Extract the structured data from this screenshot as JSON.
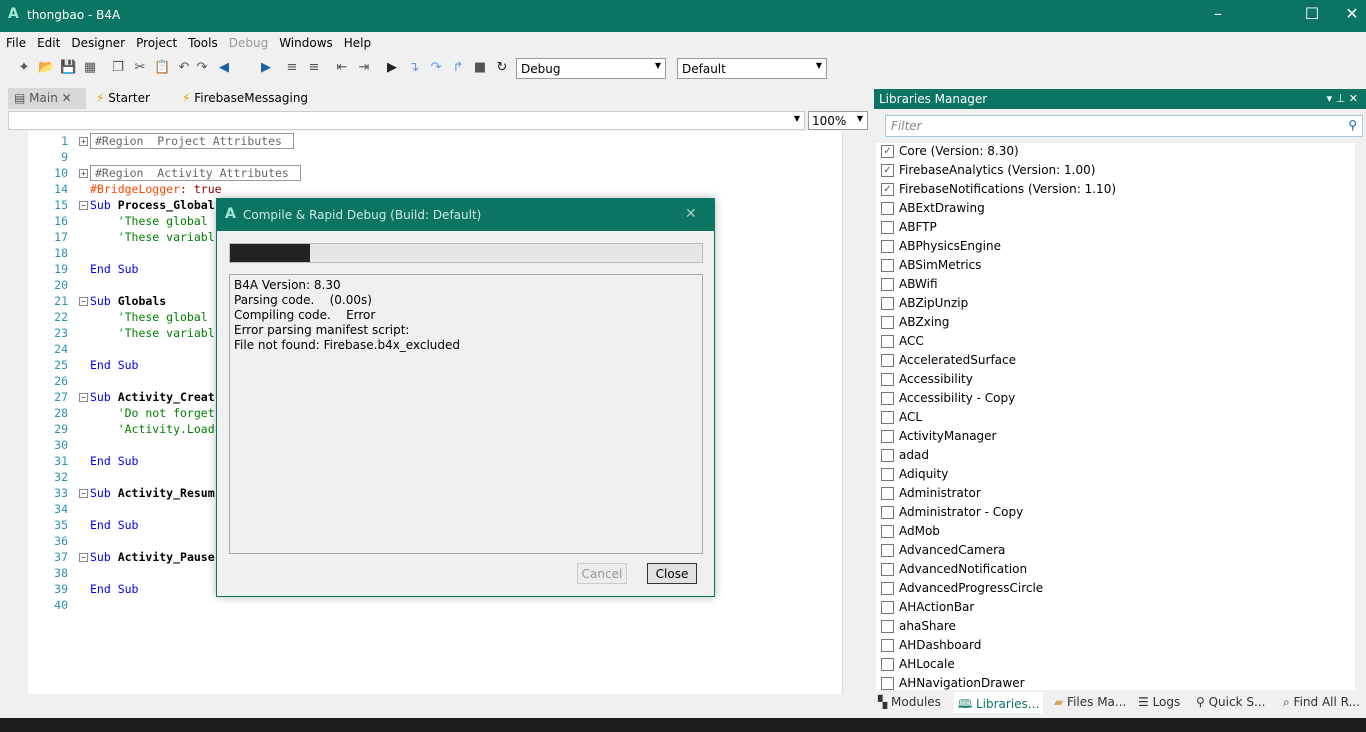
{
  "window": {
    "title": "thongbao - B4A",
    "logo": "A",
    "minimize": "–",
    "maximize": "☐",
    "close": "✕",
    "accent": "#0b7463"
  },
  "menu": [
    "File",
    "Edit",
    "Designer",
    "Project",
    "Tools",
    "Debug",
    "Windows",
    "Help"
  ],
  "toolbar": {
    "icons": [
      "new-file-icon",
      "open-icon",
      "save-icon",
      "save-all-icon",
      "copy-icon",
      "cut-icon",
      "paste-icon",
      "undo-icon",
      "redo-icon",
      "back-icon",
      "forward-icon",
      "comment-icon",
      "uncomment-icon",
      "outdent-icon",
      "indent-icon",
      "run-icon",
      "step-into-icon",
      "step-over-icon",
      "step-out-icon",
      "stop-icon",
      "restart-icon"
    ],
    "build_mode": "Debug",
    "build_config": "Default"
  },
  "tabs": [
    {
      "label": "Main",
      "icon": "designer-icon"
    },
    {
      "label": "Starter",
      "icon": "lightning-icon"
    },
    {
      "label": "FirebaseMessaging",
      "icon": "lightning-icon"
    }
  ],
  "editor": {
    "zoom": "100%",
    "lines": [
      {
        "n": "1",
        "fold": "+",
        "seg": [
          {
            "t": "#Region  Project Attributes ",
            "c": "rg"
          }
        ]
      },
      {
        "n": "9",
        "seg": []
      },
      {
        "n": "10",
        "fold": "+",
        "seg": [
          {
            "t": "#Region  Activity Attributes ",
            "c": "rg"
          }
        ]
      },
      {
        "n": "14",
        "seg": [
          {
            "t": "#BridgeLogger",
            "c": "dir"
          },
          {
            "t": ": true",
            "c": "val"
          }
        ]
      },
      {
        "n": "15",
        "fold": "-",
        "seg": [
          {
            "t": "Sub ",
            "c": "kw"
          },
          {
            "t": "Process_Global",
            "c": "id"
          }
        ]
      },
      {
        "n": "16",
        "seg": [
          {
            "t": "    'These global",
            "c": "cm"
          }
        ]
      },
      {
        "n": "17",
        "seg": [
          {
            "t": "    'These variabl",
            "c": "cm"
          }
        ]
      },
      {
        "n": "18",
        "seg": []
      },
      {
        "n": "19",
        "seg": [
          {
            "t": "End Sub",
            "c": "kw"
          }
        ]
      },
      {
        "n": "20",
        "seg": []
      },
      {
        "n": "21",
        "fold": "-",
        "seg": [
          {
            "t": "Sub ",
            "c": "kw"
          },
          {
            "t": "Globals",
            "c": "id"
          }
        ]
      },
      {
        "n": "22",
        "seg": [
          {
            "t": "    'These global",
            "c": "cm"
          }
        ]
      },
      {
        "n": "23",
        "seg": [
          {
            "t": "    'These variabl",
            "c": "cm"
          }
        ]
      },
      {
        "n": "24",
        "seg": []
      },
      {
        "n": "25",
        "seg": [
          {
            "t": "End Sub",
            "c": "kw"
          }
        ]
      },
      {
        "n": "26",
        "seg": []
      },
      {
        "n": "27",
        "fold": "-",
        "seg": [
          {
            "t": "Sub ",
            "c": "kw"
          },
          {
            "t": "Activity_Creat",
            "c": "id"
          }
        ]
      },
      {
        "n": "28",
        "seg": [
          {
            "t": "    'Do not forget",
            "c": "cm"
          }
        ]
      },
      {
        "n": "29",
        "seg": [
          {
            "t": "    'Activity.Load",
            "c": "cm"
          }
        ]
      },
      {
        "n": "30",
        "seg": []
      },
      {
        "n": "31",
        "seg": [
          {
            "t": "End Sub",
            "c": "kw"
          }
        ]
      },
      {
        "n": "32",
        "seg": []
      },
      {
        "n": "33",
        "fold": "-",
        "seg": [
          {
            "t": "Sub ",
            "c": "kw"
          },
          {
            "t": "Activity_Resum",
            "c": "id"
          }
        ]
      },
      {
        "n": "34",
        "seg": []
      },
      {
        "n": "35",
        "seg": [
          {
            "t": "End Sub",
            "c": "kw"
          }
        ]
      },
      {
        "n": "36",
        "seg": []
      },
      {
        "n": "37",
        "fold": "-",
        "seg": [
          {
            "t": "Sub ",
            "c": "kw"
          },
          {
            "t": "Activity_Pause",
            "c": "id"
          }
        ]
      },
      {
        "n": "38",
        "seg": []
      },
      {
        "n": "39",
        "seg": [
          {
            "t": "End Sub",
            "c": "kw"
          }
        ]
      },
      {
        "n": "40",
        "seg": []
      }
    ]
  },
  "libraries": {
    "title": "Libraries Manager",
    "filter_placeholder": "Filter",
    "items": [
      {
        "label": "Core (Version: 8.30)",
        "checked": true
      },
      {
        "label": "FirebaseAnalytics (Version: 1.00)",
        "checked": true
      },
      {
        "label": "FirebaseNotifications (Version: 1.10)",
        "checked": true
      },
      {
        "label": "ABExtDrawing",
        "checked": false
      },
      {
        "label": "ABFTP",
        "checked": false
      },
      {
        "label": "ABPhysicsEngine",
        "checked": false
      },
      {
        "label": "ABSimMetrics",
        "checked": false
      },
      {
        "label": "ABWifi",
        "checked": false
      },
      {
        "label": "ABZipUnzip",
        "checked": false
      },
      {
        "label": "ABZxing",
        "checked": false
      },
      {
        "label": "ACC",
        "checked": false
      },
      {
        "label": "AcceleratedSurface",
        "checked": false
      },
      {
        "label": "Accessibility",
        "checked": false
      },
      {
        "label": "Accessibility - Copy",
        "checked": false
      },
      {
        "label": "ACL",
        "checked": false
      },
      {
        "label": "ActivityManager",
        "checked": false
      },
      {
        "label": "adad",
        "checked": false
      },
      {
        "label": "Adiquity",
        "checked": false
      },
      {
        "label": "Administrator",
        "checked": false
      },
      {
        "label": "Administrator - Copy",
        "checked": false
      },
      {
        "label": "AdMob",
        "checked": false
      },
      {
        "label": "AdvancedCamera",
        "checked": false
      },
      {
        "label": "AdvancedNotification",
        "checked": false
      },
      {
        "label": "AdvancedProgressCircle",
        "checked": false
      },
      {
        "label": "AHActionBar",
        "checked": false
      },
      {
        "label": "ahaShare",
        "checked": false
      },
      {
        "label": "AHDashboard",
        "checked": false
      },
      {
        "label": "AHLocale",
        "checked": false
      },
      {
        "label": "AHNavigationDrawer",
        "checked": false
      }
    ]
  },
  "bottom_tabs": [
    {
      "label": "Modules",
      "icon": "modules-icon"
    },
    {
      "label": "Libraries...",
      "icon": "book-icon",
      "active": true
    },
    {
      "label": "Files Ma...",
      "icon": "folder-icon"
    },
    {
      "label": "Logs",
      "icon": "logs-icon"
    },
    {
      "label": "Quick S...",
      "icon": "search-icon"
    },
    {
      "label": "Find All R...",
      "icon": "find-references-icon"
    }
  ],
  "dialog": {
    "title": "Compile & Rapid Debug (Build: Default)",
    "progress_percent": 17,
    "log": [
      "B4A Version: 8.30",
      "Parsing code.    (0.00s)",
      "Compiling code.    Error",
      "Error parsing manifest script:",
      "File not found: Firebase.b4x_excluded"
    ],
    "cancel": "Cancel",
    "close": "Close",
    "close_x": "✕"
  }
}
